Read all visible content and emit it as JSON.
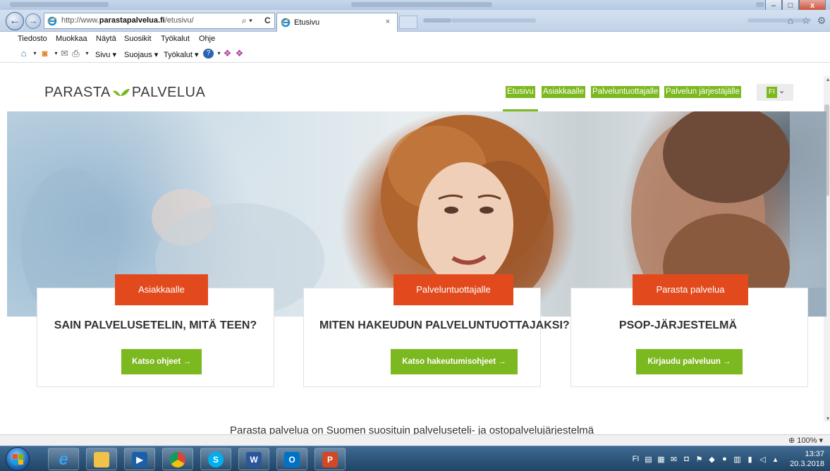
{
  "browser": {
    "address": {
      "prefix": "http://www.",
      "domain": "parastapalvelua.fi",
      "path": "/etusivu/"
    },
    "tab_title": "Etusivu",
    "tab_close": "×",
    "back": "←",
    "forward": "→",
    "search_dropdown": "⌕ ▾",
    "refresh": "C",
    "window_controls": {
      "minimize": "–",
      "maximize": "□",
      "close": "x"
    },
    "menu": [
      "Tiedosto",
      "Muokkaa",
      "Näytä",
      "Suosikit",
      "Työkalut",
      "Ohje"
    ],
    "commands": {
      "page": "Sivu ▾",
      "safety": "Suojaus ▾",
      "tools": "Työkalut ▾"
    },
    "zoom": "100%",
    "zoom_arrow": "▾"
  },
  "site": {
    "logo_left": "PARASTA",
    "logo_right": "PALVELUA",
    "nav": [
      "Etusivu",
      "Asiakkaalle",
      "Palveluntuottajalle",
      "Palvelun järjestäjälle"
    ],
    "active_nav": "Etusivu",
    "language": "FI",
    "language_chevron": "⌄",
    "cards": [
      {
        "tag": "Asiakkaalle",
        "title": "SAIN PALVELUSETELIN, MITÄ TEEN?",
        "button": "Katso ohjeet →"
      },
      {
        "tag": "Palveluntuottajalle",
        "title": "MITEN HAKEUDUN PALVELUNTUOTTAJAKSI?",
        "button": "Katso hakeutumisohjeet →"
      },
      {
        "tag": "Parasta palvelua",
        "title": "PSOP-JÄRJESTELMÄ",
        "button": "Kirjaudu palveluun →"
      }
    ],
    "intro_text": "Parasta palvelua on Suomen suosituin palveluseteli- ja ostopalvelujärjestelmä"
  },
  "colors": {
    "brand_green": "#7cb81f",
    "accent_orange": "#e24a1e"
  },
  "taskbar": {
    "apps": [
      "internet-explorer",
      "file-explorer",
      "media-player",
      "chrome",
      "skype",
      "word",
      "outlook",
      "powerpoint"
    ],
    "tray_lang": "FI",
    "time": "13:37",
    "date": "20.3.2018"
  }
}
